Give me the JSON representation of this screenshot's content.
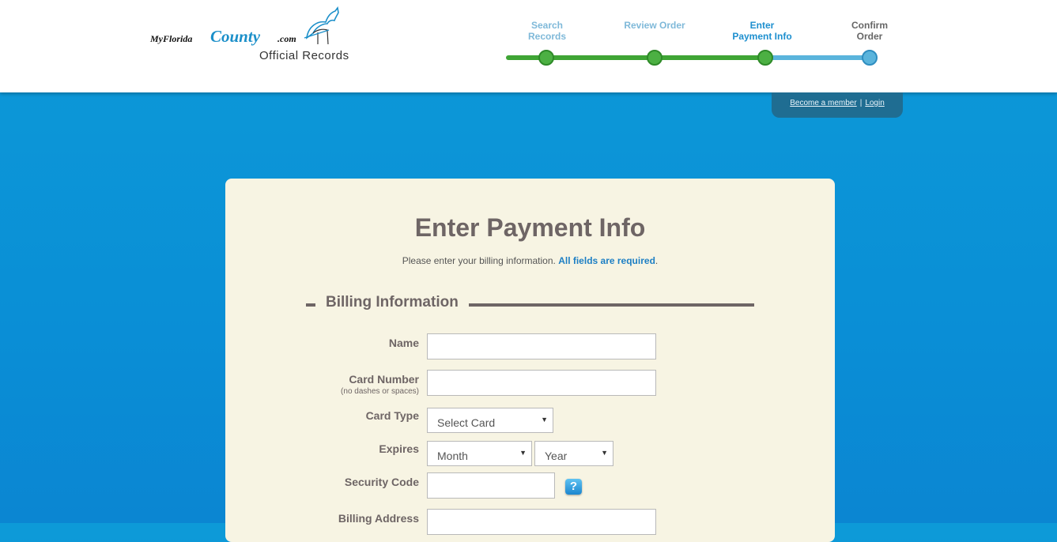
{
  "logo": {
    "part1": "MyFlorida",
    "part2": "County",
    "part3": ".com",
    "subtitle": "Official Records",
    "icon": "horse-head-icon"
  },
  "steps": [
    {
      "line1": "Search",
      "line2": "Records",
      "state": "done"
    },
    {
      "line1": "Review Order",
      "line2": "",
      "state": "done"
    },
    {
      "line1": "Enter",
      "line2": "Payment Info",
      "state": "current"
    },
    {
      "line1": "Confirm",
      "line2": "Order",
      "state": "next"
    }
  ],
  "member": {
    "become": "Become a member",
    "separator": "|",
    "login": "Login"
  },
  "page": {
    "title": "Enter Payment Info",
    "subtitle_text": "Please enter your billing information.",
    "subtitle_required": "All fields are required",
    "subtitle_end": "."
  },
  "billing": {
    "section_title": "Billing Information",
    "name_label": "Name",
    "card_number_label": "Card Number",
    "card_number_hint": "(no dashes or spaces)",
    "card_type_label": "Card Type",
    "card_type_selected": "Select Card",
    "expires_label": "Expires",
    "month_selected": "Month",
    "year_selected": "Year",
    "security_code_label": "Security Code",
    "help_icon_glyph": "?",
    "billing_address_label": "Billing Address"
  },
  "colors": {
    "accent": "#1d8fcf",
    "progress_done": "#3fa535",
    "progress_pending": "#5ab4dc",
    "card_bg": "#f7f4e3",
    "heading": "#6e6565"
  }
}
